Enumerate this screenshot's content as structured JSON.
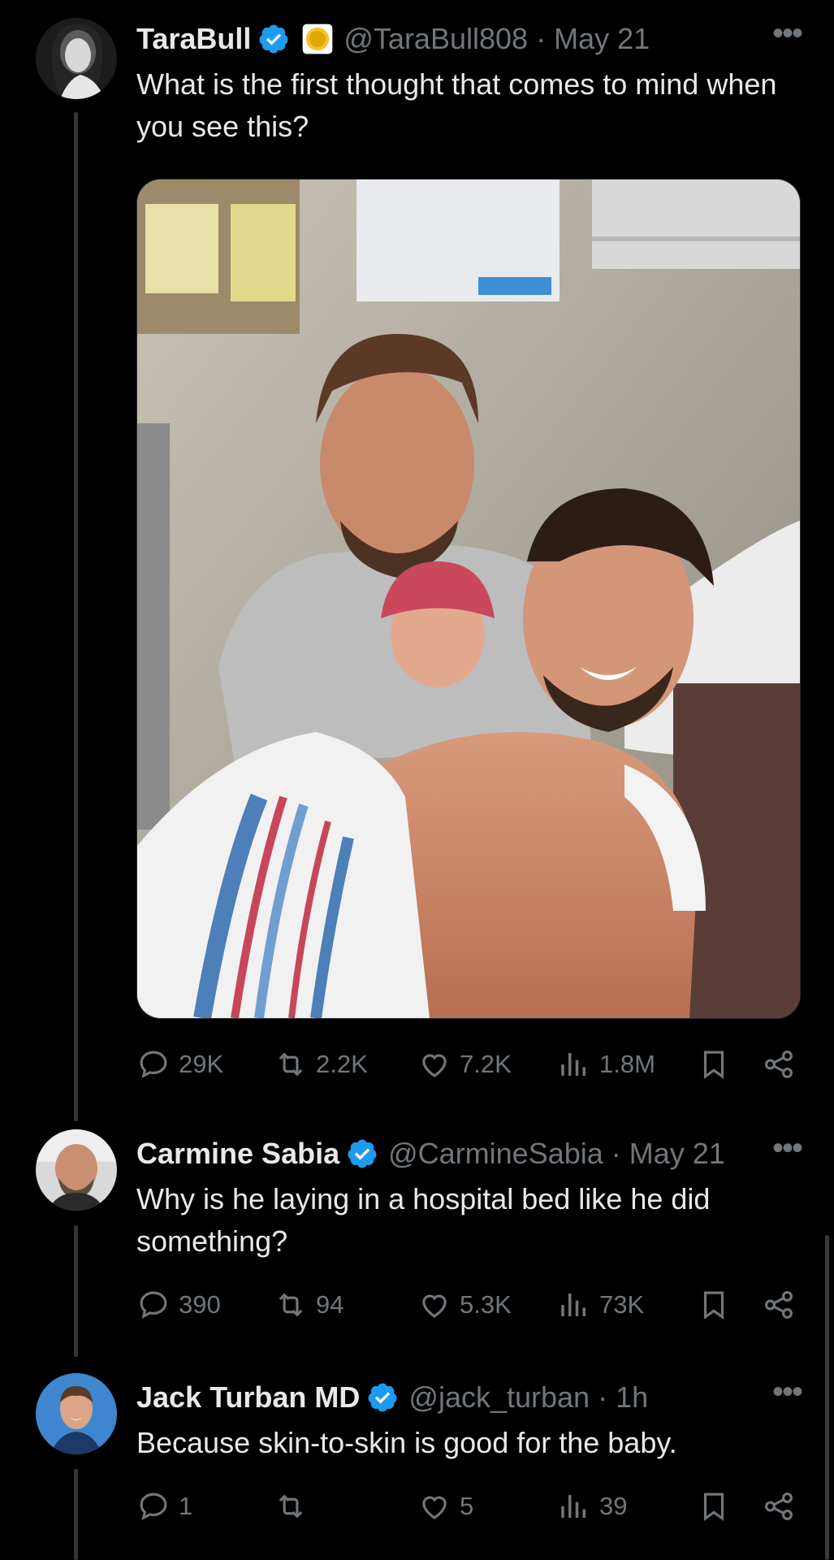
{
  "tweets": [
    {
      "name": "TaraBull",
      "handle": "@TaraBull808",
      "time": "May 21",
      "text": "What is the first thought that comes to mind when you see this?",
      "replies": "29K",
      "retweets": "2.2K",
      "likes": "7.2K",
      "views": "1.8M"
    },
    {
      "name": "Carmine Sabia",
      "handle": "@CarmineSabia",
      "time": "May 21",
      "text": "Why is he laying in a hospital bed like he did something?",
      "replies": "390",
      "retweets": "94",
      "likes": "5.3K",
      "views": "73K"
    },
    {
      "name": "Jack Turban MD",
      "handle": "@jack_turban",
      "time": "1h",
      "text": "Because skin-to-skin is good for the baby.",
      "replies": "1",
      "retweets": "",
      "likes": "5",
      "views": "39"
    }
  ],
  "separator": "·",
  "more_glyph": "•••",
  "icons": [
    "verified-badge-icon",
    "gold-badge-icon",
    "reply-icon",
    "retweet-icon",
    "like-icon",
    "views-icon",
    "bookmark-icon",
    "share-icon"
  ],
  "colors": {
    "background": "#000000",
    "text": "#e7e9ea",
    "muted": "#71767b",
    "verified": "#1d9bf0",
    "gold": "#f4c430"
  }
}
